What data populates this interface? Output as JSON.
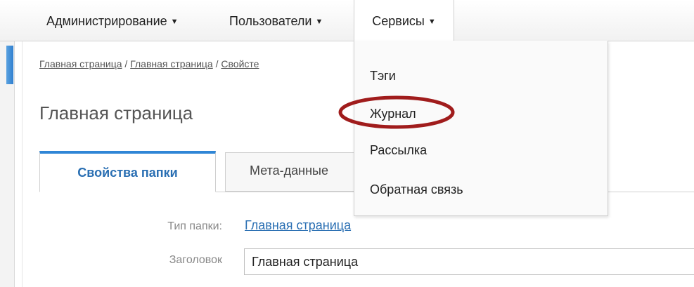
{
  "nav": {
    "items": [
      {
        "label": "Администрирование",
        "caret": "▼"
      },
      {
        "label": "Пользователи",
        "caret": "▼"
      },
      {
        "label": "Сервисы",
        "caret": "▼"
      }
    ]
  },
  "breadcrumb": {
    "items": [
      "Главная страница",
      "Главная страница",
      "Свойсте"
    ],
    "separator": " / "
  },
  "page": {
    "title": "Главная страница"
  },
  "tabs": [
    {
      "label": "Свойства папки",
      "active": true
    },
    {
      "label": "Мета-данные",
      "active": false
    }
  ],
  "form": {
    "folder_type_label": "Тип папки:",
    "folder_type_value": "Главная страница",
    "title_label": "Заголовок",
    "title_value": "Главная страница"
  },
  "dropdown": {
    "items": [
      "Тэги",
      "Журнал",
      "Рассылка",
      "Обратная связь"
    ],
    "highlighted_index": 1
  },
  "colors": {
    "accent": "#2f86d6",
    "link": "#2a6fb3",
    "highlight_ring": "#a01c1c"
  }
}
